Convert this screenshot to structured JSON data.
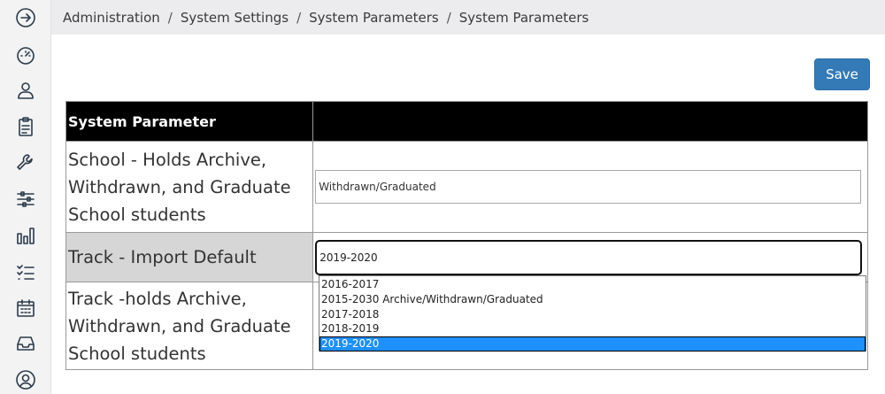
{
  "sidebar": {
    "icons": [
      {
        "name": "arrow-circle-right-icon"
      },
      {
        "name": "dashboard-gauge-icon"
      },
      {
        "name": "user-icon"
      },
      {
        "name": "clipboard-icon"
      },
      {
        "name": "wrench-icon"
      },
      {
        "name": "sliders-icon"
      },
      {
        "name": "bar-chart-icon"
      },
      {
        "name": "checklist-icon"
      },
      {
        "name": "calendar-icon"
      },
      {
        "name": "inbox-icon"
      },
      {
        "name": "account-circle-icon"
      }
    ]
  },
  "breadcrumb": {
    "items": [
      "Administration",
      "System Settings",
      "System Parameters",
      "System Parameters"
    ],
    "separator": "/"
  },
  "toolbar": {
    "save_label": "Save"
  },
  "table": {
    "headers": [
      "System Parameter",
      ""
    ],
    "rows": [
      {
        "label": "School - Holds Archive, Withdrawn, and Graduate School students",
        "value": "Withdrawn/Graduated",
        "control": "text"
      },
      {
        "label": "Track - Import Default",
        "value": "2019-2020",
        "control": "select-open"
      },
      {
        "label": "Track -holds Archive, Withdrawn, and Graduate School students",
        "value": "",
        "control": "select"
      }
    ]
  },
  "dropdown": {
    "options": [
      "2016-2017",
      "2015-2030 Archive/Withdrawn/Graduated",
      "2017-2018",
      "2018-2019",
      "2019-2020"
    ],
    "selected": "2019-2020"
  },
  "colors": {
    "accent": "#337ab7",
    "header_bg": "#000000",
    "highlight_row": "#d6d6d6",
    "selected_option": "#1e90ff"
  }
}
